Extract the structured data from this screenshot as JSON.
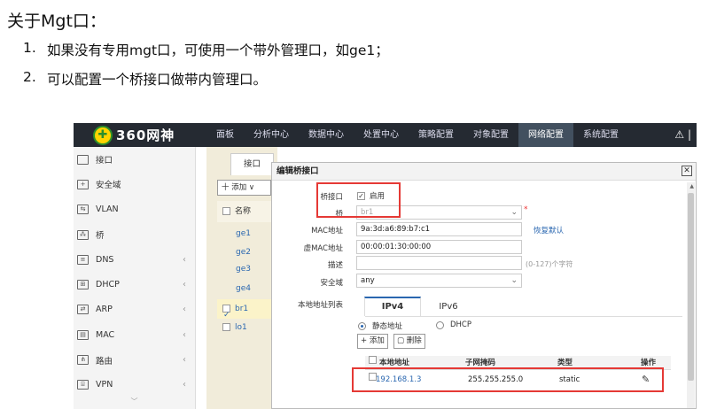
{
  "doc": {
    "heading": "关于Mgt口：",
    "items": [
      {
        "num": "1.",
        "text": "如果没有专用mgt口，可使用一个带外管理口，如ge1；"
      },
      {
        "num": "2.",
        "text": "可以配置一个桥接口做带内管理口。"
      }
    ]
  },
  "app": {
    "logo_text": "360网神",
    "nav": [
      "面板",
      "分析中心",
      "数据中心",
      "处置中心",
      "策略配置",
      "对象配置",
      "网络配置",
      "系统配置"
    ],
    "active_nav": "网络配置",
    "sidebar": [
      {
        "label": "接口",
        "icon": "interface-icon",
        "chev": ""
      },
      {
        "label": "安全域",
        "icon": "shield-icon",
        "chev": ""
      },
      {
        "label": "VLAN",
        "icon": "vlan-icon",
        "chev": ""
      },
      {
        "label": "桥",
        "icon": "bridge-icon",
        "chev": ""
      },
      {
        "label": "DNS",
        "icon": "dns-icon",
        "chev": "‹"
      },
      {
        "label": "DHCP",
        "icon": "dhcp-icon",
        "chev": "‹"
      },
      {
        "label": "ARP",
        "icon": "arp-icon",
        "chev": "‹"
      },
      {
        "label": "MAC",
        "icon": "mac-icon",
        "chev": "‹"
      },
      {
        "label": "路由",
        "icon": "route-icon",
        "chev": "‹"
      },
      {
        "label": "VPN",
        "icon": "vpn-icon",
        "chev": "‹"
      }
    ],
    "iface_tab": "接口",
    "add_button": "十 添加 ∨",
    "col_name": "名称",
    "iface_rows": [
      "ge1",
      "ge2",
      "ge3",
      "ge4",
      "br1",
      "lo1"
    ]
  },
  "dialog": {
    "title": "编辑桥接口",
    "bridge_iface_label": "桥接口",
    "enable_label": "启用",
    "bridge_label": "桥",
    "bridge_value": "br1",
    "mac_label": "MAC地址",
    "mac_value": "9a:3d:a6:89:b7:c1",
    "restore_default": "恢复默认",
    "vmac_label": "虚MAC地址",
    "vmac_value": "00:00:01:30:00:00",
    "desc_label": "描述",
    "desc_hint": "(0-127)个字符",
    "zone_label": "安全域",
    "zone_value": "any",
    "addr_list_label": "本地地址列表",
    "tab_ipv4": "IPv4",
    "tab_ipv6": "IPv6",
    "radio_static": "静态地址",
    "radio_dhcp": "DHCP",
    "btn_add": "+ 添加",
    "btn_delete": "删除",
    "table_headers": [
      "本地地址",
      "子网掩码",
      "类型",
      "操作"
    ],
    "table_row": {
      "ip": "192.168.1.3",
      "mask": "255.255.255.0",
      "type": "static"
    }
  }
}
